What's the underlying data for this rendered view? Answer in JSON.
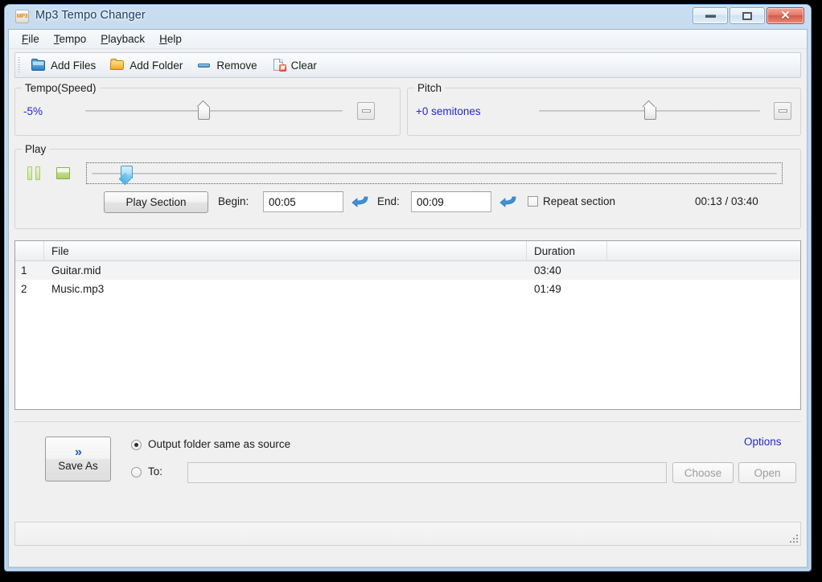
{
  "window": {
    "title": "Mp3 Tempo Changer",
    "app_icon_text": "MP3",
    "minimize_label": "–",
    "maximize_label": "□",
    "close_label": "✕"
  },
  "menu": {
    "items": [
      {
        "label": "File",
        "mnemonic": "F"
      },
      {
        "label": "Tempo",
        "mnemonic": "T"
      },
      {
        "label": "Playback",
        "mnemonic": "P"
      },
      {
        "label": "Help",
        "mnemonic": "H"
      }
    ]
  },
  "toolbar": {
    "buttons": [
      {
        "label": "Add Files",
        "icon": "folder-blue-icon"
      },
      {
        "label": "Add Folder",
        "icon": "folder-yellow-icon"
      },
      {
        "label": "Remove",
        "icon": "minus-icon"
      },
      {
        "label": "Clear",
        "icon": "page-delete-icon"
      }
    ]
  },
  "tempo": {
    "group_title": "Tempo(Speed)",
    "value": "-5%",
    "slider_percent": 46,
    "reset_tooltip": "reset-icon"
  },
  "pitch": {
    "group_title": "Pitch",
    "value": "+0 semitones",
    "slider_percent": 50,
    "reset_tooltip": "reset-icon"
  },
  "play": {
    "group_title": "Play",
    "pause_icon": "pause-icon",
    "stop_icon": "stop-icon",
    "seek_percent": 5,
    "play_section_label": "Play Section",
    "begin_label": "Begin:",
    "begin_value": "00:05",
    "end_label": "End:",
    "end_value": "00:09",
    "repeat_label": "Repeat section",
    "repeat_checked": false,
    "time_display": "00:13 / 03:40"
  },
  "filelist": {
    "columns": [
      "",
      "File",
      "Duration",
      ""
    ],
    "rows": [
      {
        "index": "1",
        "file": "Guitar.mid",
        "duration": "03:40"
      },
      {
        "index": "2",
        "file": "Music.mp3",
        "duration": "01:49"
      }
    ]
  },
  "output": {
    "save_as_label": "Save As",
    "save_as_icon": "double-chevron-right-icon",
    "radio_same_label": "Output folder same as source",
    "radio_same_checked": true,
    "radio_to_label": "To:",
    "radio_to_checked": false,
    "to_value": "",
    "choose_label": "Choose",
    "open_label": "Open",
    "options_label": "Options"
  },
  "statusbar": {
    "text": ""
  },
  "colors": {
    "accent_blue": "#2727d0",
    "title_text": "#1d3f63",
    "frame": "#b5d2ea",
    "client_bg": "#f0f0f0",
    "row_alt": "#f4f4f4"
  }
}
